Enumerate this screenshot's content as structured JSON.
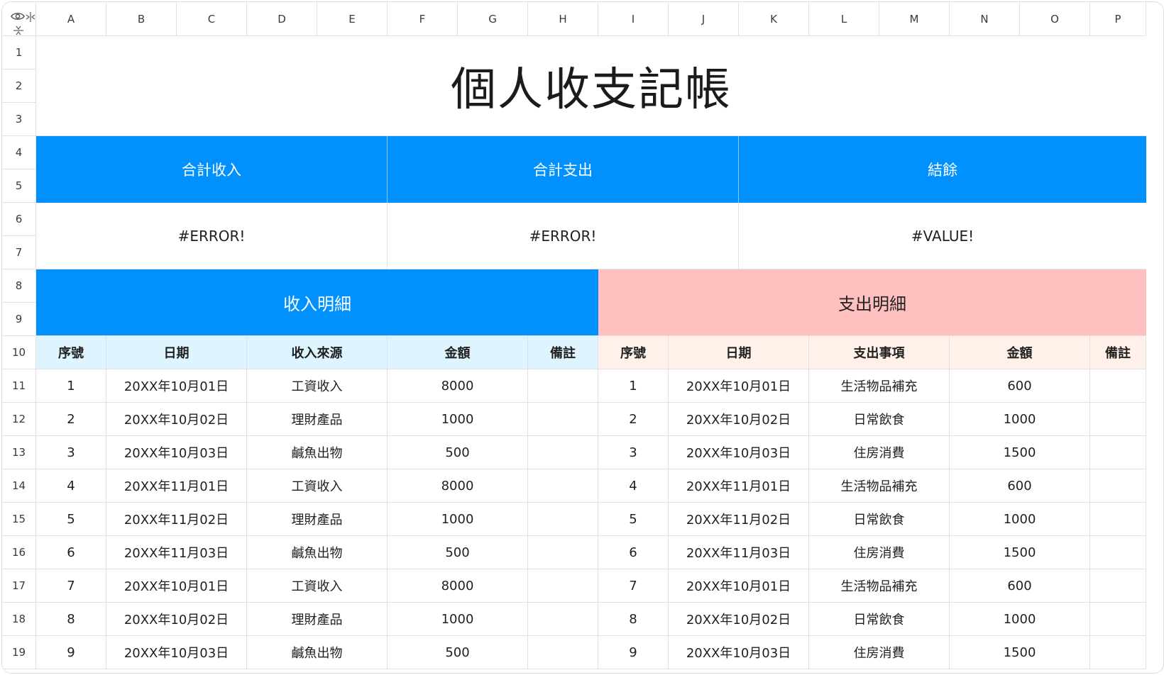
{
  "columns": [
    "A",
    "B",
    "C",
    "D",
    "E",
    "F",
    "G",
    "H",
    "I",
    "J",
    "K",
    "L",
    "M",
    "N",
    "O",
    "P"
  ],
  "rows": [
    "1",
    "2",
    "3",
    "4",
    "5",
    "6",
    "7",
    "8",
    "9",
    "10",
    "11",
    "12",
    "13",
    "14",
    "15",
    "16",
    "17",
    "18",
    "19"
  ],
  "title": "個人收支記帳",
  "summary": {
    "income_label": "合計收入",
    "expense_label": "合計支出",
    "balance_label": "結餘",
    "income_value": "#ERROR!",
    "expense_value": "#ERROR!",
    "balance_value": "#VALUE!"
  },
  "income": {
    "section_label": "收入明細",
    "headers": [
      "序號",
      "日期",
      "收入來源",
      "金額",
      "備註"
    ],
    "rows": [
      [
        "1",
        "20XX年10月01日",
        "工資收入",
        "8000",
        ""
      ],
      [
        "2",
        "20XX年10月02日",
        "理財產品",
        "1000",
        ""
      ],
      [
        "3",
        "20XX年10月03日",
        "鹹魚出物",
        "500",
        ""
      ],
      [
        "4",
        "20XX年11月01日",
        "工資收入",
        "8000",
        ""
      ],
      [
        "5",
        "20XX年11月02日",
        "理財產品",
        "1000",
        ""
      ],
      [
        "6",
        "20XX年11月03日",
        "鹹魚出物",
        "500",
        ""
      ],
      [
        "7",
        "20XX年10月01日",
        "工資收入",
        "8000",
        ""
      ],
      [
        "8",
        "20XX年10月02日",
        "理財產品",
        "1000",
        ""
      ],
      [
        "9",
        "20XX年10月03日",
        "鹹魚出物",
        "500",
        ""
      ]
    ]
  },
  "expense": {
    "section_label": "支出明細",
    "headers": [
      "序號",
      "日期",
      "支出事項",
      "金額",
      "備註"
    ],
    "rows": [
      [
        "1",
        "20XX年10月01日",
        "生活物品補充",
        "600",
        ""
      ],
      [
        "2",
        "20XX年10月02日",
        "日常飲食",
        "1000",
        ""
      ],
      [
        "3",
        "20XX年10月03日",
        "住房消費",
        "1500",
        ""
      ],
      [
        "4",
        "20XX年11月01日",
        "生活物品補充",
        "600",
        ""
      ],
      [
        "5",
        "20XX年11月02日",
        "日常飲食",
        "1000",
        ""
      ],
      [
        "6",
        "20XX年11月03日",
        "住房消費",
        "1500",
        ""
      ],
      [
        "7",
        "20XX年10月01日",
        "生活物品補充",
        "600",
        ""
      ],
      [
        "8",
        "20XX年10月02日",
        "日常飲食",
        "1000",
        ""
      ],
      [
        "9",
        "20XX年10月03日",
        "住房消費",
        "1500",
        ""
      ]
    ]
  },
  "colors": {
    "blue": "#0091ff",
    "pink": "#ffc0c0",
    "income_header_bg": "#def4ff",
    "expense_header_bg": "#fff0ea",
    "grid_line": "#e1e1e1"
  },
  "icons": {
    "corner": [
      "eye-icon",
      "column-resize-icon",
      "row-resize-icon"
    ]
  }
}
